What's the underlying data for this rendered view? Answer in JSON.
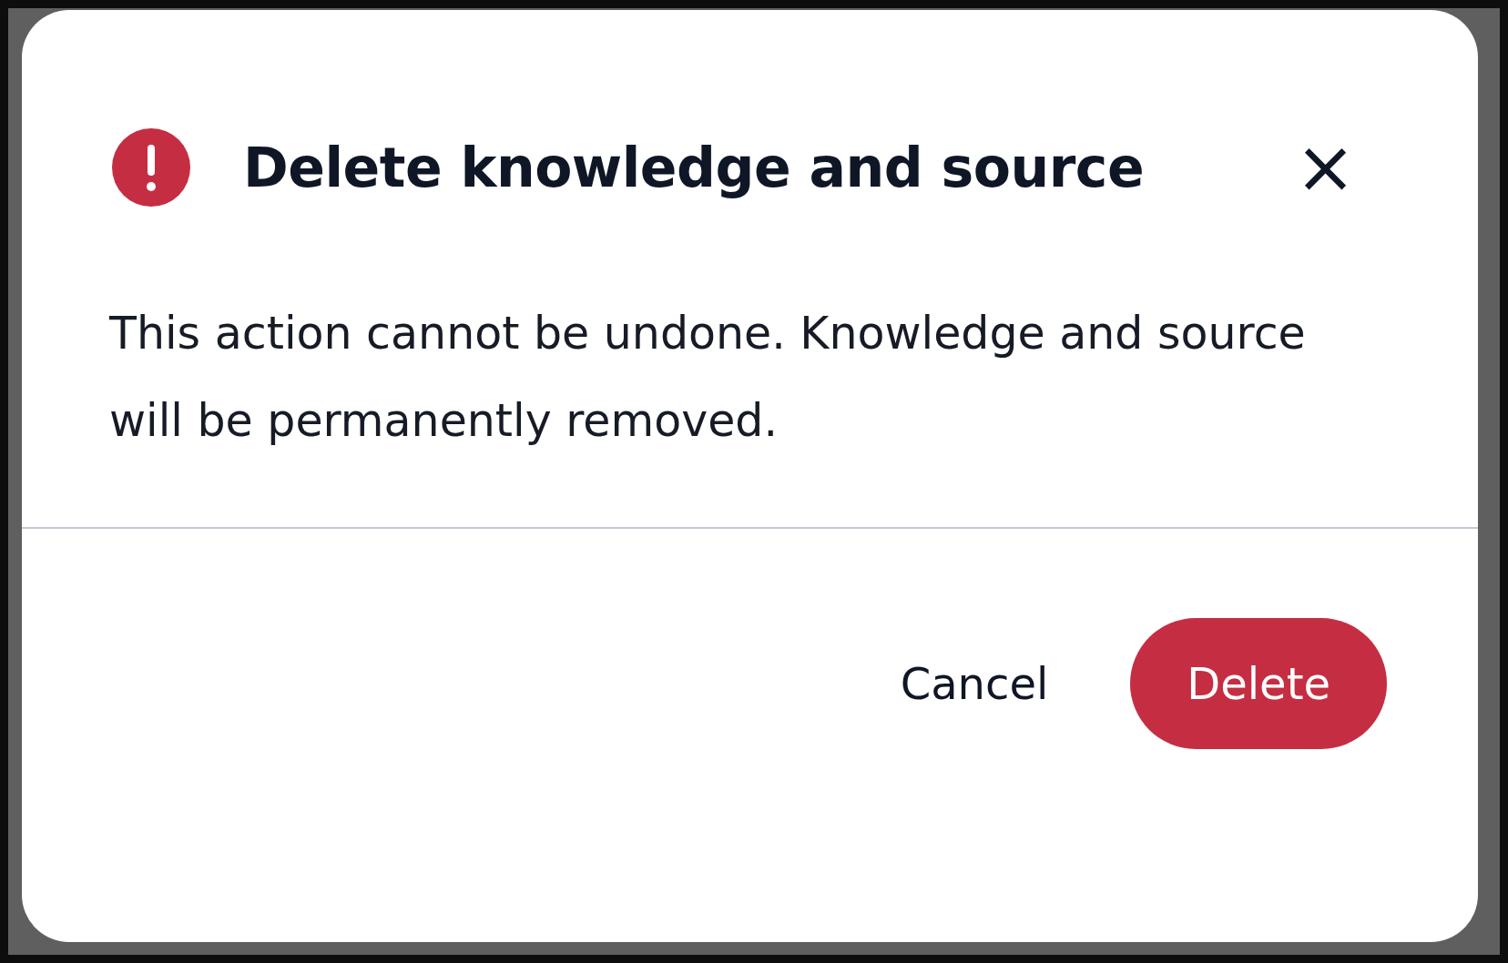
{
  "dialog": {
    "title": "Delete knowledge and source",
    "message": "This action cannot be undone. Knowledge and source will be permanently removed.",
    "close": "×",
    "buttons": [
      {
        "label": "Cancel",
        "kind": "secondary"
      },
      {
        "label": "Delete",
        "kind": "danger"
      }
    ]
  }
}
